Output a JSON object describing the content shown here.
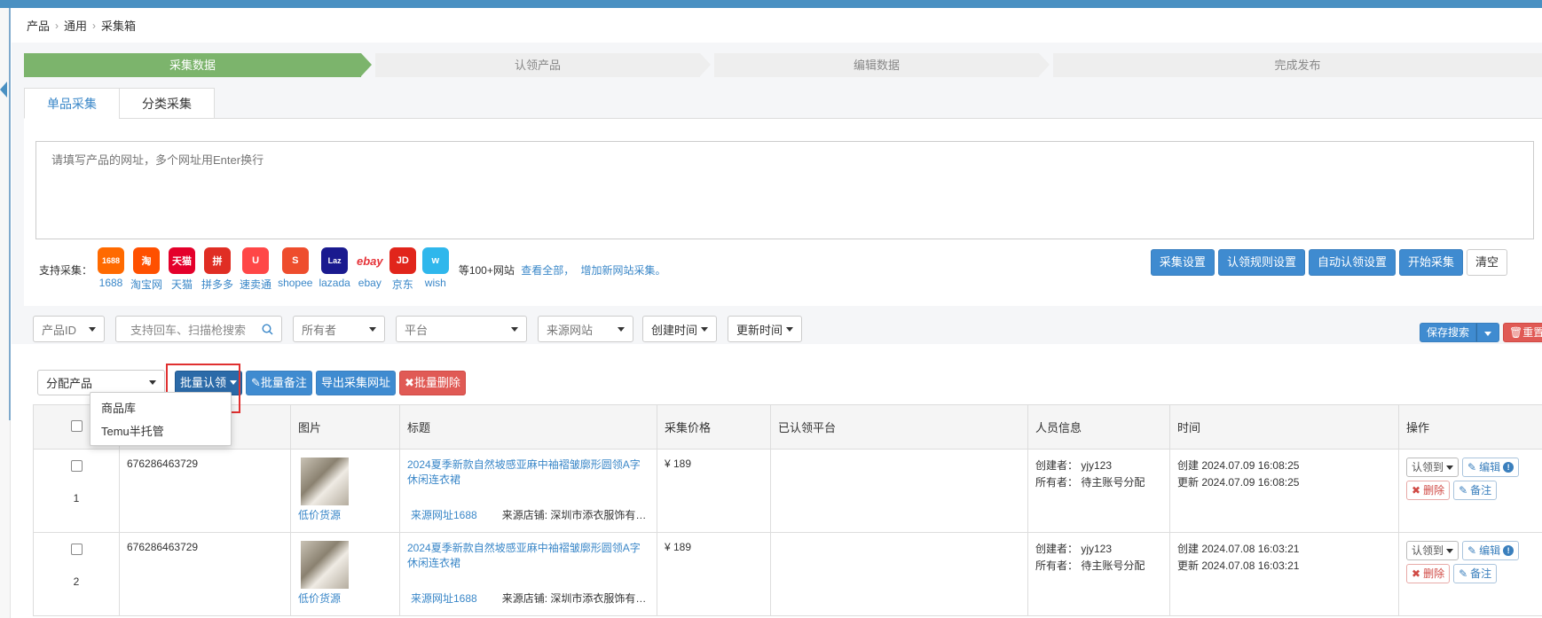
{
  "breadcrumb": [
    "产品",
    "通用",
    "采集箱"
  ],
  "steps": [
    "采集数据",
    "认领产品",
    "编辑数据",
    "完成发布"
  ],
  "tabs": [
    "单品采集",
    "分类采集"
  ],
  "url_input": {
    "placeholder": "请填写产品的网址，多个网址用Enter换行"
  },
  "support": {
    "label": "支持采集：",
    "sites": [
      {
        "name": "1688",
        "icon": "1688-icon",
        "color": "#ff6a00",
        "glyph": "1688"
      },
      {
        "name": "淘宝网",
        "icon": "taobao-icon",
        "color": "#ff5000",
        "glyph": "淘"
      },
      {
        "name": "天猫",
        "icon": "tmall-icon",
        "color": "#e4002b",
        "glyph": "天猫"
      },
      {
        "name": "拼多多",
        "icon": "pinduoduo-icon",
        "color": "#e02e24",
        "glyph": "拼"
      },
      {
        "name": "速卖通",
        "icon": "aliexpress-icon",
        "color": "#ff4747",
        "glyph": "U"
      },
      {
        "name": "shopee",
        "icon": "shopee-icon",
        "color": "#ee4d2d",
        "glyph": "S"
      },
      {
        "name": "lazada",
        "icon": "lazada-icon",
        "color": "#1a1a8f",
        "glyph": "Laz"
      },
      {
        "name": "ebay",
        "icon": "ebay-icon",
        "color": "#ffffff",
        "glyph": "ebay"
      },
      {
        "name": "京东",
        "icon": "jd-icon",
        "color": "#e1251b",
        "glyph": "JD"
      },
      {
        "name": "wish",
        "icon": "wish-icon",
        "color": "#2fb7ec",
        "glyph": "w"
      }
    ],
    "more_text": "等100+网站",
    "view_all": "查看全部，",
    "add_site": "增加新网站采集。"
  },
  "top_actions": [
    "采集设置",
    "认领规则设置",
    "自动认领设置",
    "开始采集",
    "清空"
  ],
  "filters": {
    "product_id": "产品ID",
    "search_placeholder": "支持回车、扫描枪搜索",
    "owner": "所有者",
    "platform": "平台",
    "source_site": "来源网站",
    "created_time": "创建时间",
    "updated_time": "更新时间",
    "save_search": "保存搜索",
    "reset": "重置"
  },
  "toolbar": {
    "assign": "分配产品",
    "batch_claim": "批量认领",
    "batch_note": "批量备注",
    "export_urls": "导出采集网址",
    "batch_delete": "批量删除"
  },
  "claim_menu": [
    "商品库",
    "Temu半托管"
  ],
  "table": {
    "headers": [
      "",
      "",
      "图片",
      "标题",
      "采集价格",
      "已认领平台",
      "人员信息",
      "时间",
      "操作"
    ],
    "rows": [
      {
        "index": "1",
        "id": "676286463729",
        "low_price": "低价货源",
        "title": "2024夏季新款自然坡感亚麻中袖褶皱廓形圆领A字休闲连衣裙",
        "source_link": "来源网址1688",
        "shop": "来源店铺: 深圳市添衣服饰有限公司",
        "price": "¥ 189",
        "platform": "",
        "creator": "创建者： yjy123",
        "owner": "所有者： 待主账号分配",
        "created": "创建 2024.07.09 16:08:25",
        "updated": "更新 2024.07.09 16:08:25"
      },
      {
        "index": "2",
        "id": "676286463729",
        "low_price": "低价货源",
        "title": "2024夏季新款自然坡感亚麻中袖褶皱廓形圆领A字休闲连衣裙",
        "source_link": "来源网址1688",
        "shop": "来源店铺: 深圳市添衣服饰有限公司",
        "price": "¥ 189",
        "platform": "",
        "creator": "创建者： yjy123",
        "owner": "所有者： 待主账号分配",
        "created": "创建 2024.07.08 16:03:21",
        "updated": "更新 2024.07.08 16:03:21"
      }
    ],
    "ops": {
      "claim_to": "认领到",
      "edit": "编辑",
      "delete": "删除",
      "note": "备注"
    }
  }
}
